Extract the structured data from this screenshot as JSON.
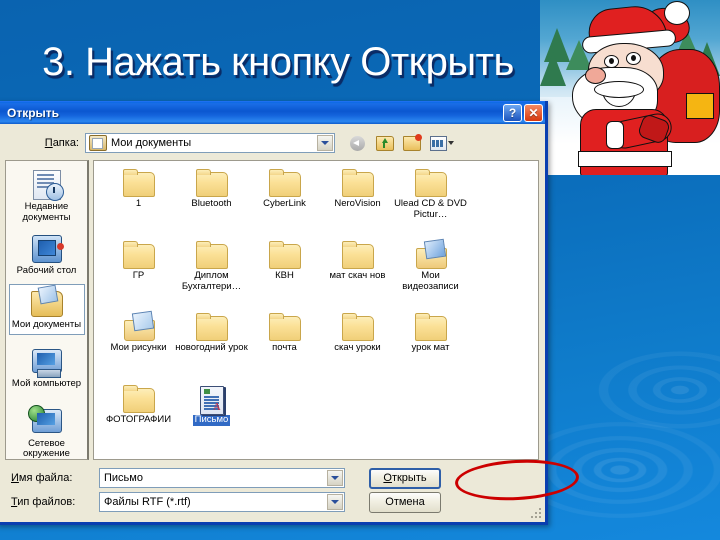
{
  "slide": {
    "title": "3. Нажать кнопку Открыть",
    "background_color": "#0a6ab8",
    "decor_image": "santa-claus-with-sack"
  },
  "dialog": {
    "title": "Открыть",
    "help_button": "?",
    "close_button": "✕",
    "folder_label": "Папка:",
    "folder_value": "Мои документы",
    "toolbar": [
      {
        "name": "back-icon",
        "label": "Назад"
      },
      {
        "name": "up-one-level-icon",
        "label": "Вверх"
      },
      {
        "name": "new-folder-icon",
        "label": "Создать папку"
      },
      {
        "name": "views-icon",
        "label": "Вид"
      }
    ],
    "places": [
      {
        "label": "Недавние документы",
        "icon": "recent-documents-icon",
        "selected": false
      },
      {
        "label": "Рабочий стол",
        "icon": "desktop-icon",
        "selected": false
      },
      {
        "label": "Мои документы",
        "icon": "my-documents-icon",
        "selected": true
      },
      {
        "label": "Мой компьютер",
        "icon": "my-computer-icon",
        "selected": false
      },
      {
        "label": "Сетевое окружение",
        "icon": "network-places-icon",
        "selected": false
      }
    ],
    "files": [
      {
        "label": "1",
        "type": "folder",
        "selected": false
      },
      {
        "label": "Bluetooth",
        "type": "folder",
        "selected": false
      },
      {
        "label": "CyberLink",
        "type": "folder",
        "selected": false
      },
      {
        "label": "NeroVision",
        "type": "folder",
        "selected": false
      },
      {
        "label": "Ulead CD & DVD Pictur…",
        "type": "folder",
        "selected": false
      },
      {
        "label": "ГР",
        "type": "folder",
        "selected": false
      },
      {
        "label": "Диплом Бухгалтери…",
        "type": "folder",
        "selected": false
      },
      {
        "label": "КВН",
        "type": "folder",
        "selected": false
      },
      {
        "label": "мат скач нов",
        "type": "folder",
        "selected": false
      },
      {
        "label": "Мои видеозаписи",
        "type": "folder-video",
        "selected": false
      },
      {
        "label": "Мои рисунки",
        "type": "folder-pictures",
        "selected": false
      },
      {
        "label": "новогодний урок",
        "type": "folder",
        "selected": false
      },
      {
        "label": "почта",
        "type": "folder",
        "selected": false
      },
      {
        "label": "скач уроки",
        "type": "folder",
        "selected": false
      },
      {
        "label": "урок мат",
        "type": "folder",
        "selected": false
      },
      {
        "label": "ФОТОГРАФИИ",
        "type": "folder",
        "selected": false
      },
      {
        "label": "Письмо",
        "type": "document",
        "selected": true
      }
    ],
    "filename_label": "Имя файла:",
    "filename_value": "Письмо",
    "filetype_label": "Тип файлов:",
    "filetype_value": "Файлы RTF (*.rtf)",
    "open_button": "Открыть",
    "cancel_button": "Отмена"
  },
  "annotation": {
    "shape": "red-ellipse",
    "color": "#cc0000",
    "target": "Открыть"
  }
}
